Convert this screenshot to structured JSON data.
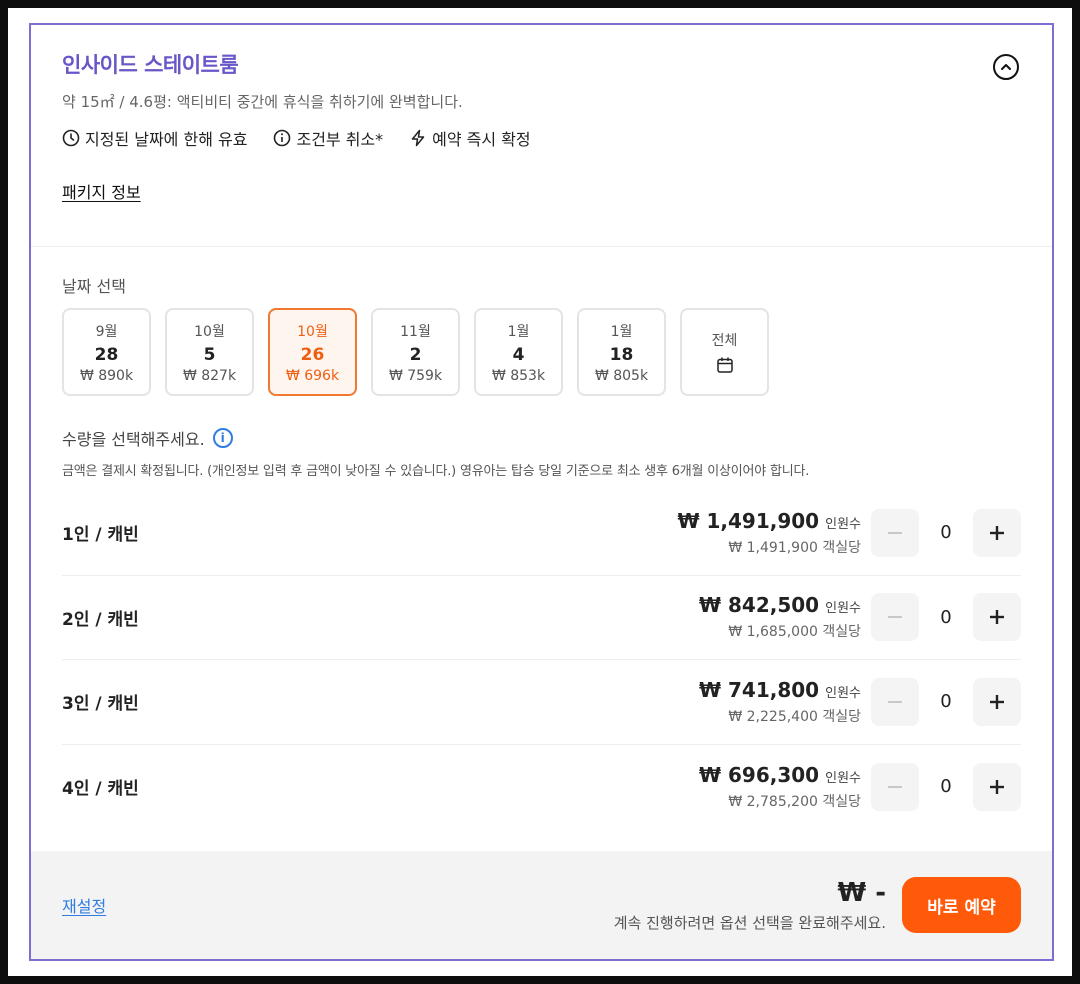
{
  "room": {
    "title": "인사이드 스테이트룸",
    "description": "약 15㎡ / 4.6평: 액티비티 중간에 휴식을 취하기에 완벽합니다.",
    "features": [
      {
        "icon": "clock-icon",
        "label": "지정된 날짜에 한해 유효"
      },
      {
        "icon": "info-icon",
        "label": "조건부 취소*"
      },
      {
        "icon": "lightning-icon",
        "label": "예약 즉시 확정"
      }
    ],
    "package_link": "패키지 정보"
  },
  "date_select": {
    "label": "날짜 선택",
    "dates": [
      {
        "month": "9월",
        "day": "28",
        "price": "₩ 890k",
        "selected": false
      },
      {
        "month": "10월",
        "day": "5",
        "price": "₩ 827k",
        "selected": false
      },
      {
        "month": "10월",
        "day": "26",
        "price": "₩ 696k",
        "selected": true
      },
      {
        "month": "11월",
        "day": "2",
        "price": "₩ 759k",
        "selected": false
      },
      {
        "month": "1월",
        "day": "4",
        "price": "₩ 853k",
        "selected": false
      },
      {
        "month": "1월",
        "day": "18",
        "price": "₩ 805k",
        "selected": false
      }
    ],
    "all_label": "전체"
  },
  "quantity": {
    "label": "수량을 선택해주세요.",
    "notice": "금액은 결제시 확정됩니다. (개인정보 입력 후 금액이 낮아질 수 있습니다.) 영유아는 탑승 당일 기준으로 최소 생후 6개월 이상이어야 합니다.",
    "rows": [
      {
        "label": "1인 / 캐빈",
        "price_per_person": "₩ 1,491,900",
        "per_person_unit": "인원수",
        "price_per_room": "₩ 1,491,900 객실당",
        "qty": "0"
      },
      {
        "label": "2인 / 캐빈",
        "price_per_person": "₩ 842,500",
        "per_person_unit": "인원수",
        "price_per_room": "₩ 1,685,000 객실당",
        "qty": "0"
      },
      {
        "label": "3인 / 캐빈",
        "price_per_person": "₩ 741,800",
        "per_person_unit": "인원수",
        "price_per_room": "₩ 2,225,400 객실당",
        "qty": "0"
      },
      {
        "label": "4인 / 캐빈",
        "price_per_person": "₩ 696,300",
        "per_person_unit": "인원수",
        "price_per_room": "₩ 2,785,200 객실당",
        "qty": "0"
      }
    ]
  },
  "footer": {
    "reset_label": "재설정",
    "total": "₩ -",
    "message": "계속 진행하려면 옵션 선택을 완료해주세요.",
    "book_label": "바로 예약"
  },
  "colors": {
    "accent_purple": "#6757c8",
    "accent_orange": "#ff5a0a",
    "link_blue": "#2f7de1"
  }
}
